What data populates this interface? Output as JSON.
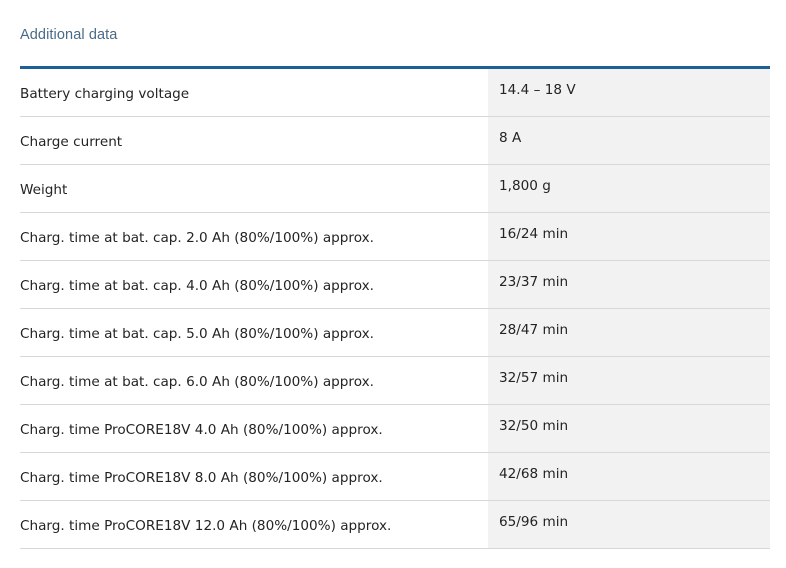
{
  "section": {
    "title": "Additional data"
  },
  "rows": [
    {
      "label": "Battery charging voltage",
      "value": "14.4 – 18 V"
    },
    {
      "label": "Charge current",
      "value": "8 A"
    },
    {
      "label": "Weight",
      "value": "1,800 g"
    },
    {
      "label": "Charg. time at bat. cap. 2.0 Ah (80%/100%) approx.",
      "value": "16/24 min"
    },
    {
      "label": "Charg. time at bat. cap. 4.0 Ah (80%/100%) approx.",
      "value": "23/37 min"
    },
    {
      "label": "Charg. time at bat. cap. 5.0 Ah (80%/100%) approx.",
      "value": "28/47 min"
    },
    {
      "label": "Charg. time at bat. cap. 6.0 Ah (80%/100%) approx.",
      "value": "32/57 min"
    },
    {
      "label": "Charg. time ProCORE18V 4.0 Ah (80%/100%) approx.",
      "value": "32/50 min"
    },
    {
      "label": "Charg. time ProCORE18V 8.0 Ah (80%/100%) approx.",
      "value": "42/68 min"
    },
    {
      "label": "Charg. time ProCORE18V 12.0 Ah (80%/100%) approx.",
      "value": "65/96 min"
    }
  ]
}
